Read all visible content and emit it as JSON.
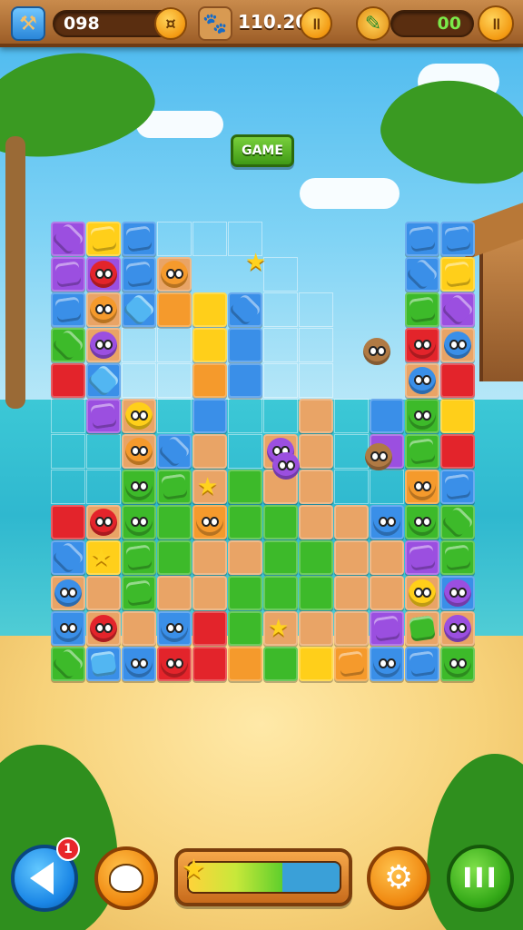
{
  "hud": {
    "left_counter": "098",
    "middle_value": "110.20",
    "right_counter": "00"
  },
  "game_badge": "GAME",
  "notification_count": "1",
  "progress": {
    "fill_fraction": 0.62
  },
  "colors": {
    "purple": "#9b4fe0",
    "blue": "#3a8fe8",
    "yellow": "#ffcf1a",
    "red": "#e3242b",
    "green": "#3dba2a",
    "orange": "#f59a2c",
    "sand": "#e9a466",
    "lightblue": "#52b6f2"
  }
}
